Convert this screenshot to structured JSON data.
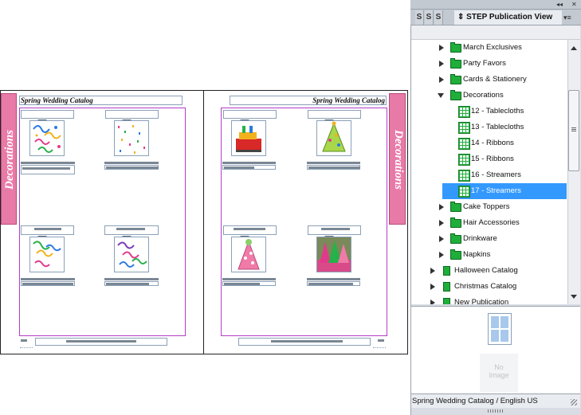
{
  "document": {
    "header_text": "Spring Wedding Catalog",
    "section_tab": "Decorations"
  },
  "panel": {
    "side_tabs": [
      "S",
      "S",
      "S"
    ],
    "title": "STEP Publication View",
    "collapse_glyph": "◂◂",
    "close_glyph": "✕",
    "menu_glyph": "▾≡",
    "tree": [
      {
        "label": "March Exclusives",
        "icon": "folder-icon",
        "state": "collapsed"
      },
      {
        "label": "Party Favors",
        "icon": "folder-icon",
        "state": "collapsed"
      },
      {
        "label": "Cards & Stationery",
        "icon": "folder-icon",
        "state": "collapsed"
      },
      {
        "label": "Decorations",
        "icon": "folder-icon",
        "state": "expanded"
      },
      {
        "label": "12 - Tablecloths",
        "icon": "page-grid-icon",
        "state": "leaf"
      },
      {
        "label": "13 - Tablecloths",
        "icon": "page-grid-icon",
        "state": "leaf"
      },
      {
        "label": "14 - Ribbons",
        "icon": "page-grid-icon",
        "state": "leaf"
      },
      {
        "label": "15 - Ribbons",
        "icon": "page-grid-icon",
        "state": "leaf"
      },
      {
        "label": "16 - Streamers",
        "icon": "page-grid-icon",
        "state": "leaf"
      },
      {
        "label": "17 - Streamers",
        "icon": "page-grid-icon",
        "state": "leaf",
        "selected": true
      },
      {
        "label": "Cake Toppers",
        "icon": "folder-icon",
        "state": "collapsed"
      },
      {
        "label": "Hair Accessories",
        "icon": "folder-icon",
        "state": "collapsed"
      },
      {
        "label": "Drinkware",
        "icon": "folder-icon",
        "state": "collapsed"
      },
      {
        "label": "Napkins",
        "icon": "folder-icon",
        "state": "collapsed"
      },
      {
        "label": "Halloween Catalog",
        "icon": "catalog-icon",
        "state": "collapsed"
      },
      {
        "label": "Christmas Catalog",
        "icon": "catalog-icon",
        "state": "collapsed"
      },
      {
        "label": "New Publication",
        "icon": "catalog-icon",
        "state": "collapsed"
      }
    ],
    "preview_placeholder_line1": "No",
    "preview_placeholder_line2": "Image",
    "status_text": "Spring Wedding Catalog / English US"
  },
  "colors": {
    "selection": "#3399ff",
    "tab_pink": "#e87aa8",
    "margin_guide": "#b43cc8",
    "folder_green": "#1fae3a"
  }
}
